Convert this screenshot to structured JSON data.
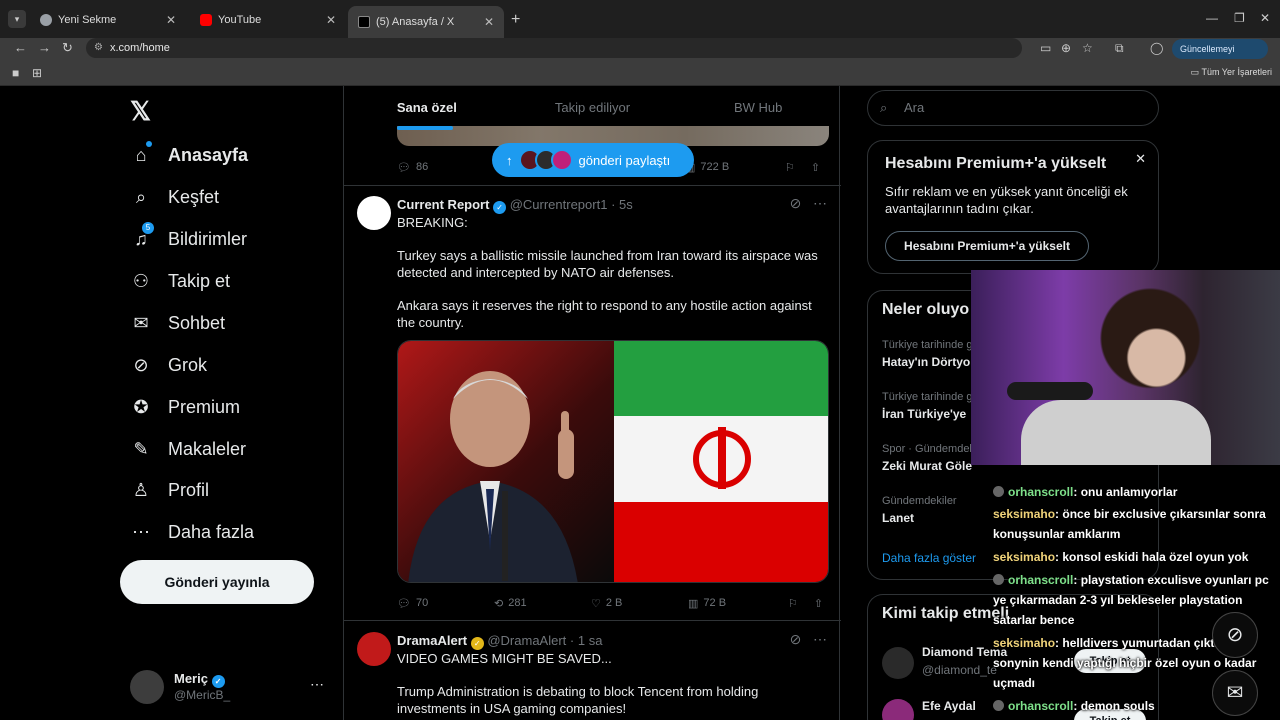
{
  "browser": {
    "tabs": [
      {
        "label": "Yeni Sekme",
        "active": false
      },
      {
        "label": "YouTube",
        "active": false
      },
      {
        "label": "(5) Anasayfa / X",
        "active": true
      }
    ],
    "url": "x.com/home",
    "update_label": "Güncellemeyi tamamla",
    "bookmarks_all": "Tüm Yer İşaretleri"
  },
  "nav": {
    "items": [
      {
        "label": "Anasayfa",
        "icon": "home-icon"
      },
      {
        "label": "Keşfet",
        "icon": "search-icon"
      },
      {
        "label": "Bildirimler",
        "icon": "bell-icon",
        "badge": "5"
      },
      {
        "label": "Takip et",
        "icon": "follow-icon"
      },
      {
        "label": "Sohbet",
        "icon": "mail-icon"
      },
      {
        "label": "Grok",
        "icon": "grok-icon"
      },
      {
        "label": "Premium",
        "icon": "verified-icon"
      },
      {
        "label": "Makaleler",
        "icon": "article-icon"
      },
      {
        "label": "Profil",
        "icon": "person-icon"
      },
      {
        "label": "Daha fazla",
        "icon": "more-icon"
      }
    ],
    "post_button": "Gönderi yayınla",
    "account": {
      "name": "Meriç",
      "handle": "@MericB_"
    }
  },
  "timeline": {
    "tabs": [
      "Sana özel",
      "Takip ediliyor",
      "BW Hub"
    ],
    "share_pill": "gönderi paylaştı",
    "prev_actions": {
      "reply": "86",
      "views": "722 B"
    },
    "tweets": [
      {
        "name": "Current Report",
        "handle": "@Currentreport1",
        "time": "· 5s",
        "avatar_text": "Current Report",
        "lines": [
          "BREAKING:",
          "Turkey says a ballistic missile launched from Iran toward its airspace was detected and intercepted by NATO air defenses.",
          "Ankara says it reserves the right to respond to any hostile action against the country."
        ],
        "replies": "70",
        "reposts": "281",
        "likes": "2 B",
        "views": "72 B"
      },
      {
        "name": "DramaAlert",
        "handle": "@DramaAlert",
        "time": "· 1 sa",
        "avatar_text": "DramaAlert",
        "lines": [
          "VIDEO GAMES MIGHT BE SAVED...",
          "Trump Administration is debating to block Tencent from holding investments in USA gaming companies!"
        ]
      }
    ]
  },
  "right": {
    "search_placeholder": "Ara",
    "premium": {
      "title": "Hesabını Premium+'a yükselt",
      "desc": "Sıfır reklam ve en yüksek yanıt önceliği ek avantajlarının tadını çıkar.",
      "button": "Hesabını Premium+'a yükselt"
    },
    "trends_title": "Neler oluyo",
    "trends": [
      {
        "ctx": "Türkiye tarihinde g",
        "name": "Hatay'ın Dörtyo"
      },
      {
        "ctx": "Türkiye tarihinde g",
        "name": "İran Türkiye'ye"
      },
      {
        "ctx": "Spor · Gündemdek",
        "name": "Zeki Murat Göle"
      },
      {
        "ctx": "Gündemdekiler",
        "name": "Lanet"
      }
    ],
    "show_more": "Daha fazla göster",
    "wtf_title": "Kimi takip etmeli",
    "wtf": [
      {
        "name": "Diamond Tema",
        "handle": "@diamond_te",
        "button": "Takip et"
      },
      {
        "name": "Efe Aydal",
        "handle": "",
        "button": "Takip et"
      }
    ]
  },
  "chat": [
    {
      "user": "orhanscroll",
      "color": "g",
      "text": ": onu anlamıyorlar"
    },
    {
      "user": "seksimaho",
      "color": "y",
      "text": ": önce bir exclusive çıkarsınlar sonra konuşsunlar amklarım"
    },
    {
      "user": "seksimaho",
      "color": "y",
      "text": ": konsol eskidi hala özel oyun yok"
    },
    {
      "user": "orhanscroll",
      "color": "g",
      "text": ": playstation exculisve oyunları pc ye çıkarmadan 2-3 yıl bekleseler playstation satarlar bence"
    },
    {
      "user": "seksimaho",
      "color": "y",
      "text": ": helldivers yumurtadan çıktı ama sonynin kendi yaptığı hiçbir özel oyun o kadar uçmadı"
    },
    {
      "user": "orhanscroll",
      "color": "g",
      "text": ": demon souls"
    }
  ]
}
